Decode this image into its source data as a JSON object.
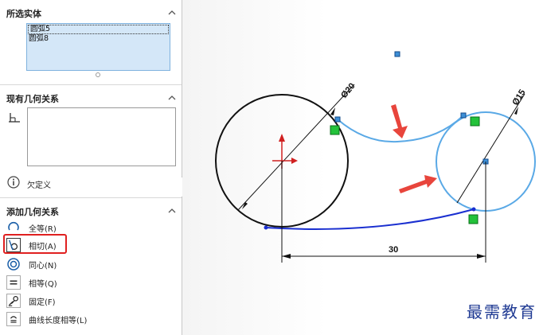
{
  "selected_entities": {
    "title": "所选实体",
    "items": [
      "圆弧5",
      "圆弧8"
    ]
  },
  "existing_relations": {
    "title": "现有几何关系"
  },
  "status": {
    "label": "欠定义"
  },
  "add_relations": {
    "title": "添加几何关系",
    "options": [
      {
        "label": "全等(R)",
        "icon": "coincident-arc-icon"
      },
      {
        "label": "相切(A)",
        "icon": "tangent-icon"
      },
      {
        "label": "同心(N)",
        "icon": "concentric-icon"
      },
      {
        "label": "相等(Q)",
        "icon": "equal-icon"
      },
      {
        "label": "固定(F)",
        "icon": "fix-icon"
      },
      {
        "label": "曲线长度相等(L)",
        "icon": "equal-curve-length-icon"
      }
    ]
  },
  "sketch": {
    "dim_left_circle": "Ø20",
    "dim_right_circle": "Ø15",
    "dim_distance": "30"
  },
  "watermark": "最需教育",
  "colors": {
    "highlight_box": "#e02020",
    "selected_curve": "#5aa9e6",
    "blue_curve": "#1a2fd0",
    "arrow": "#e8453c"
  }
}
